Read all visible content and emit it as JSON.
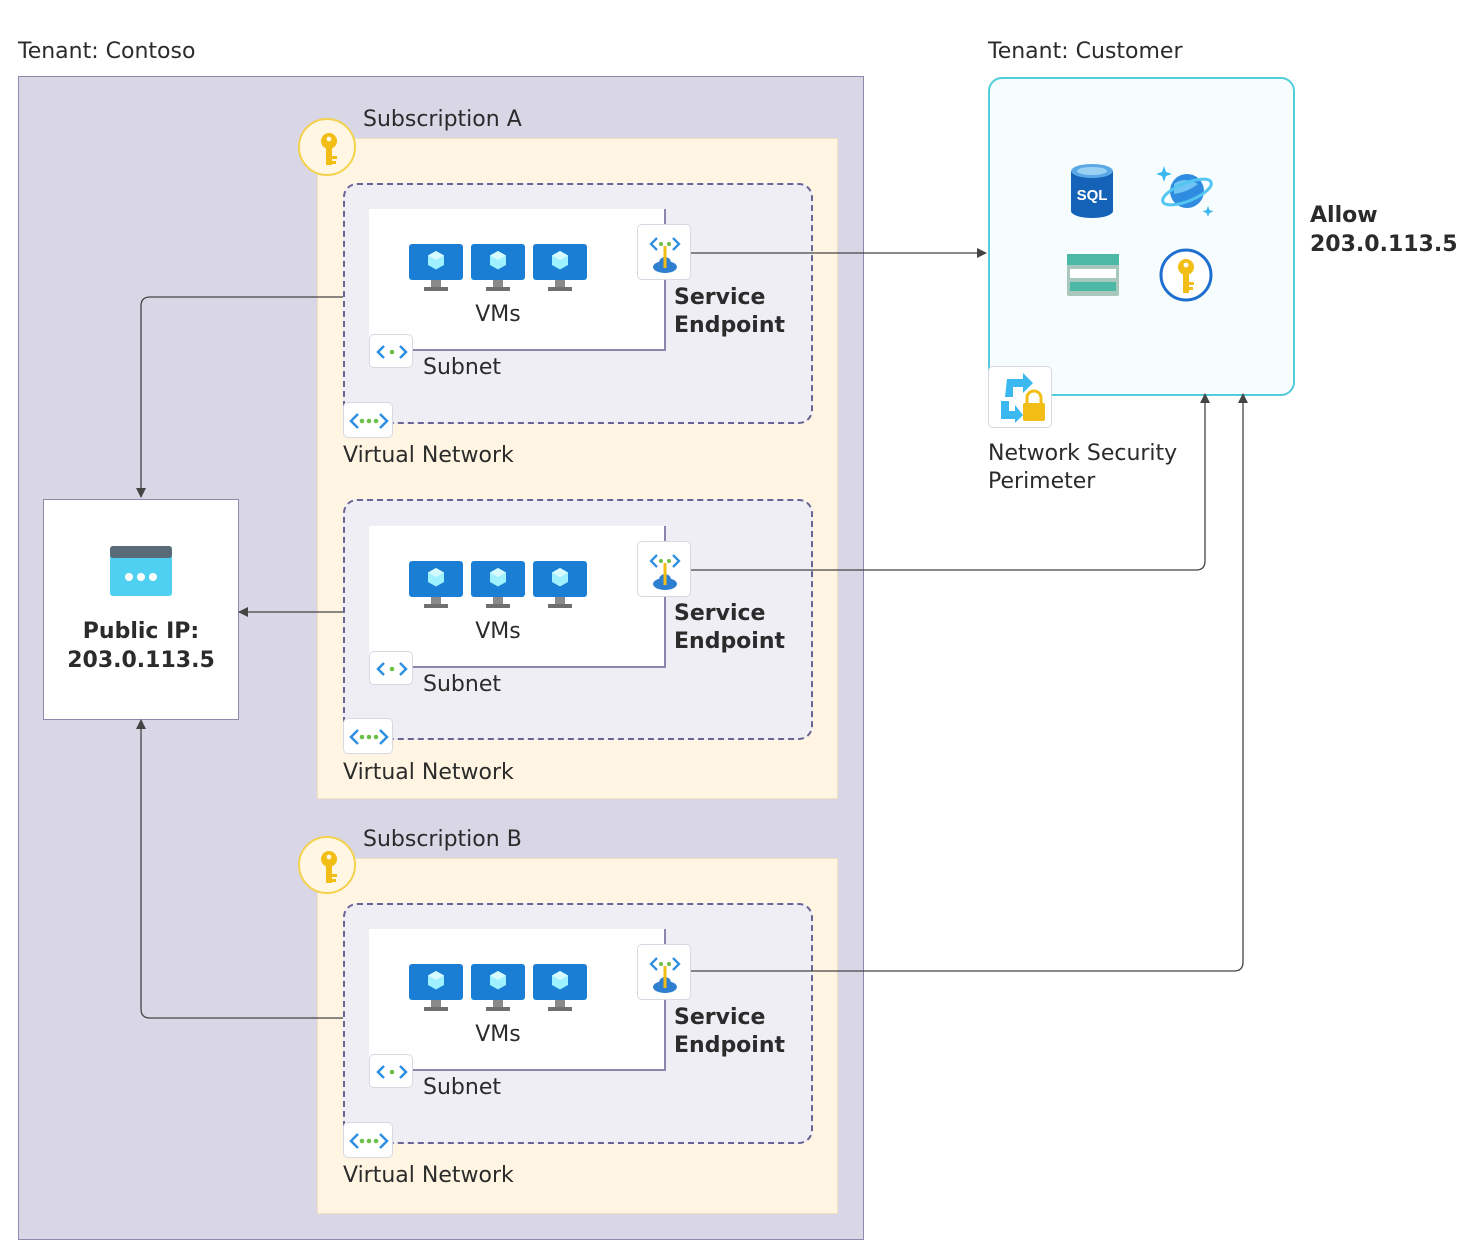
{
  "tenants": {
    "contoso": {
      "label": "Tenant: Contoso"
    },
    "customer": {
      "label": "Tenant: Customer"
    }
  },
  "subscriptions": [
    {
      "label": "Subscription A"
    },
    {
      "label": "Subscription B"
    }
  ],
  "vnets": [
    {
      "vm_label": "VMs",
      "subnet_label": "Subnet",
      "vnet_label": "Virtual Network",
      "endpoint_label_line1": "Service",
      "endpoint_label_line2": "Endpoint"
    },
    {
      "vm_label": "VMs",
      "subnet_label": "Subnet",
      "vnet_label": "Virtual Network",
      "endpoint_label_line1": "Service",
      "endpoint_label_line2": "Endpoint"
    },
    {
      "vm_label": "VMs",
      "subnet_label": "Subnet",
      "vnet_label": "Virtual Network",
      "endpoint_label_line1": "Service",
      "endpoint_label_line2": "Endpoint"
    }
  ],
  "public_ip": {
    "title": "Public IP:",
    "address": "203.0.113.5"
  },
  "nsp": {
    "label_line1": "Network Security",
    "label_line2": "Perimeter"
  },
  "allow_rule": {
    "line1": "Allow",
    "line2": "203.0.113.5"
  },
  "customer_services": [
    {
      "icon": "sql-database-icon",
      "text": "SQL"
    },
    {
      "icon": "cosmos-db-icon"
    },
    {
      "icon": "storage-account-icon"
    },
    {
      "icon": "key-vault-icon"
    }
  ],
  "colors": {
    "tenant_contoso_bg": "#d9d6e6",
    "subscription_bg": "#fff5e2",
    "vnet_bg": "#efeef5",
    "customer_border": "#52ccd8",
    "vm_blue": "#1a7fd4",
    "key_yellow": "#f2bd14",
    "connector": "#444444"
  }
}
